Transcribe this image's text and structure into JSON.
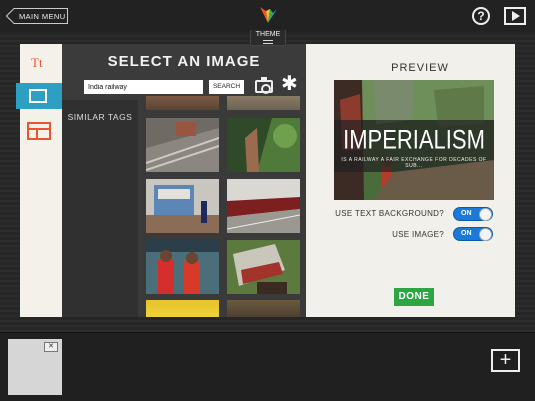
{
  "header": {
    "main_menu_label": "MAIN MENU",
    "help_label": "?",
    "theme_label": "THEME"
  },
  "sidebar": {
    "text_tool_label": "Tt"
  },
  "select_panel": {
    "title": "SELECT AN IMAGE",
    "search_value": "India railway",
    "search_button": "SEARCH",
    "similar_tags_label": "SIMILAR TAGS",
    "star_glyph": "✱"
  },
  "preview": {
    "title": "PREVIEW",
    "headline": "IMPERIALISM",
    "subtitle": "IS A RAILWAY A FAIR EXCHANGE FOR DECADES OF SUB...",
    "use_text_background_label": "USE TEXT BACKGROUND?",
    "use_image_label": "USE IMAGE?",
    "toggle_on_label": "ON",
    "done_label": "DONE"
  },
  "slides": {
    "close_glyph": "✕",
    "add_glyph": "+"
  },
  "colors": {
    "accent_blue": "#2c9fc2",
    "toggle_blue": "#1a7ad9",
    "done_green": "#2da642",
    "accent_orange": "#e8552f"
  }
}
